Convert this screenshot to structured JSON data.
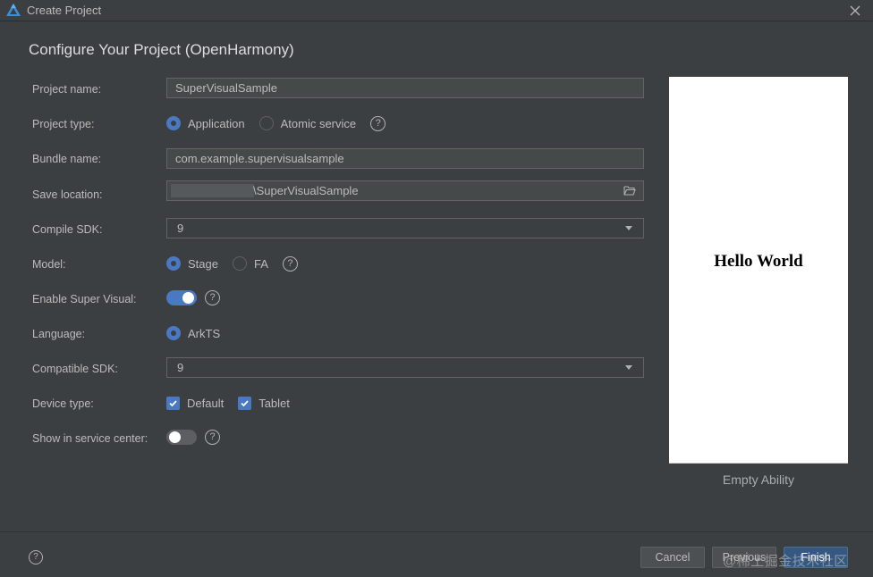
{
  "window": {
    "title": "Create Project",
    "logo_icon": "deveco-logo-icon",
    "close_icon": "close-icon"
  },
  "heading": "Configure Your Project (OpenHarmony)",
  "form": {
    "project_name": {
      "label": "Project name:",
      "value": "SuperVisualSample"
    },
    "project_type": {
      "label": "Project type:",
      "options": [
        {
          "label": "Application",
          "selected": true
        },
        {
          "label": "Atomic service",
          "selected": false
        }
      ]
    },
    "bundle_name": {
      "label": "Bundle name:",
      "value": "com.example.supervisualsample"
    },
    "save_location": {
      "label": "Save location:",
      "value": "\\SuperVisualSample"
    },
    "compile_sdk": {
      "label": "Compile SDK:",
      "value": "9"
    },
    "model": {
      "label": "Model:",
      "options": [
        {
          "label": "Stage",
          "selected": true
        },
        {
          "label": "FA",
          "selected": false
        }
      ]
    },
    "enable_super_visual": {
      "label": "Enable Super Visual:",
      "enabled": true
    },
    "language": {
      "label": "Language:",
      "options": [
        {
          "label": "ArkTS",
          "selected": true
        }
      ]
    },
    "compatible_sdk": {
      "label": "Compatible SDK:",
      "value": "9"
    },
    "device_type": {
      "label": "Device type:",
      "options": [
        {
          "label": "Default",
          "checked": true
        },
        {
          "label": "Tablet",
          "checked": true
        }
      ]
    },
    "show_in_service_center": {
      "label": "Show in service center:",
      "enabled": false
    },
    "help_glyph": "?"
  },
  "preview": {
    "text": "Hello World",
    "template_name": "Empty Ability"
  },
  "footer": {
    "help_glyph": "?",
    "cancel": "Cancel",
    "previous": "Previous",
    "finish": "Finish",
    "watermark": "@稀土掘金技术社区"
  },
  "colors": {
    "accent": "#4a78c2",
    "background": "#3c3f41",
    "primary_button": "#365880"
  }
}
